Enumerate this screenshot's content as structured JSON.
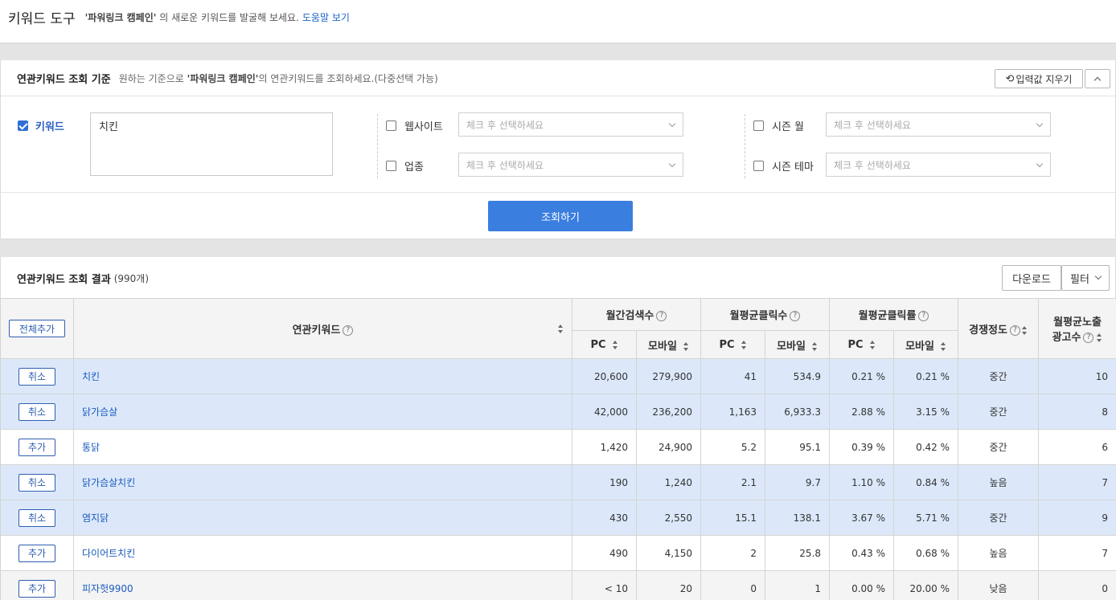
{
  "header": {
    "title": "키워드 도구",
    "campaign": "'파워링크 캠페인'",
    "subtitle": "의 새로운 키워드를 발굴해 보세요.",
    "help_link": "도움말 보기"
  },
  "criteria": {
    "title": "연관키워드 조회 기준",
    "desc_prefix": "원하는 기준으로",
    "desc_campaign": "'파워링크 캠페인'",
    "desc_suffix": "의 연관키워드를 조회하세요.(다중선택 가능)",
    "reset_label": "입력값 지우기",
    "keyword_label": "키워드",
    "keyword_value": "치킨",
    "website_label": "웹사이트",
    "industry_label": "업종",
    "season_month_label": "시즌 월",
    "season_theme_label": "시즌 테마",
    "select_placeholder": "체크 후 선택하세요",
    "search_button": "조회하기"
  },
  "results": {
    "title": "연관키워드 조회 결과",
    "count": "(990개)",
    "download_label": "다운로드",
    "filter_label": "필터",
    "add_all_label": "전체추가",
    "columns": {
      "keyword": "연관키워드",
      "monthly_search": "월간검색수",
      "avg_clicks": "월평균클릭수",
      "avg_ctr": "월평균클릭률",
      "competition": "경쟁정도",
      "ad_count_line1": "월평균노출",
      "ad_count_line2": "광고수",
      "pc": "PC",
      "mobile": "모바일"
    },
    "rows": [
      {
        "action": "취소",
        "keyword": "치킨",
        "search_pc": "20,600",
        "search_mobile": "279,900",
        "click_pc": "41",
        "click_mobile": "534.9",
        "ctr_pc": "0.21 %",
        "ctr_mobile": "0.21 %",
        "competition": "중간",
        "ads": "10",
        "state": "sel"
      },
      {
        "action": "취소",
        "keyword": "닭가슴살",
        "search_pc": "42,000",
        "search_mobile": "236,200",
        "click_pc": "1,163",
        "click_mobile": "6,933.3",
        "ctr_pc": "2.88 %",
        "ctr_mobile": "3.15 %",
        "competition": "중간",
        "ads": "8",
        "state": "sel"
      },
      {
        "action": "추가",
        "keyword": "통닭",
        "search_pc": "1,420",
        "search_mobile": "24,900",
        "click_pc": "5.2",
        "click_mobile": "95.1",
        "ctr_pc": "0.39 %",
        "ctr_mobile": "0.42 %",
        "competition": "중간",
        "ads": "6",
        "state": ""
      },
      {
        "action": "취소",
        "keyword": "닭가슴살치킨",
        "search_pc": "190",
        "search_mobile": "1,240",
        "click_pc": "2.1",
        "click_mobile": "9.7",
        "ctr_pc": "1.10 %",
        "ctr_mobile": "0.84 %",
        "competition": "높음",
        "ads": "7",
        "state": "sel"
      },
      {
        "action": "취소",
        "keyword": "염지닭",
        "search_pc": "430",
        "search_mobile": "2,550",
        "click_pc": "15.1",
        "click_mobile": "138.1",
        "ctr_pc": "3.67 %",
        "ctr_mobile": "5.71 %",
        "competition": "중간",
        "ads": "9",
        "state": "sel"
      },
      {
        "action": "추가",
        "keyword": "다이어트치킨",
        "search_pc": "490",
        "search_mobile": "4,150",
        "click_pc": "2",
        "click_mobile": "25.8",
        "ctr_pc": "0.43 %",
        "ctr_mobile": "0.68 %",
        "competition": "높음",
        "ads": "7",
        "state": ""
      },
      {
        "action": "추가",
        "keyword": "피자헛9900",
        "search_pc": "< 10",
        "search_mobile": "20",
        "click_pc": "0",
        "click_mobile": "1",
        "ctr_pc": "0.00 %",
        "ctr_mobile": "20.00 %",
        "competition": "낮음",
        "ads": "0",
        "state": "alt"
      }
    ]
  }
}
